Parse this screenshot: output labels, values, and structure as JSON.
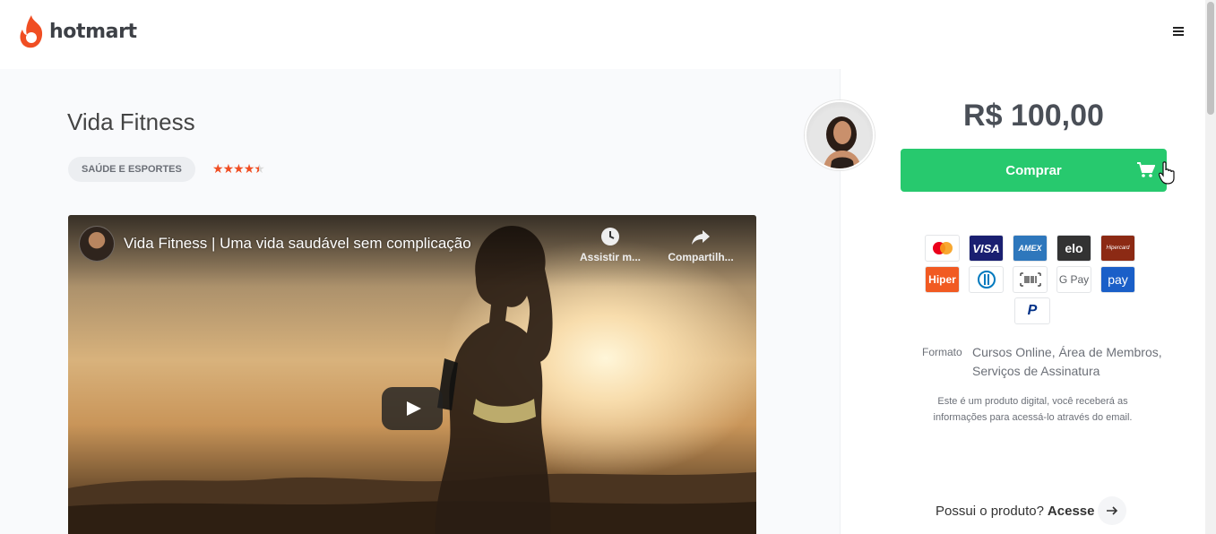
{
  "header": {
    "brand": "hotmart",
    "brand_color": "#f04e23"
  },
  "product": {
    "title": "Vida Fitness",
    "category": "SAÚDE E ESPORTES",
    "rating": 4.5,
    "rating_max": 5
  },
  "video": {
    "title": "Vida Fitness | Uma vida saudável sem complicação",
    "watch_later_label": "Assistir m...",
    "share_label": "Compartilh..."
  },
  "purchase": {
    "price": "R$ 100,00",
    "buy_label": "Comprar",
    "buy_color": "#27c96e"
  },
  "payment_methods": [
    {
      "name": "mastercard-icon"
    },
    {
      "name": "visa-icon",
      "label": "VISA"
    },
    {
      "name": "amex-icon",
      "label": "AMEX"
    },
    {
      "name": "elo-icon",
      "label": "elo"
    },
    {
      "name": "hipercard-icon",
      "label": "Hipercard"
    },
    {
      "name": "hiper-icon",
      "label": "Hiper"
    },
    {
      "name": "diners-icon"
    },
    {
      "name": "boleto-icon"
    },
    {
      "name": "google-pay-icon",
      "label": "G Pay"
    },
    {
      "name": "samsung-pay-icon",
      "label": "pay"
    },
    {
      "name": "paypal-icon",
      "label": "P"
    }
  ],
  "details": {
    "format_label": "Formato",
    "format_value": "Cursos Online, Área de Membros, Serviços de Assinatura",
    "digital_note": "Este é um produto digital, você receberá as informações para acessá-lo através do email."
  },
  "access": {
    "question": "Possui o produto?",
    "link": "Acesse"
  }
}
